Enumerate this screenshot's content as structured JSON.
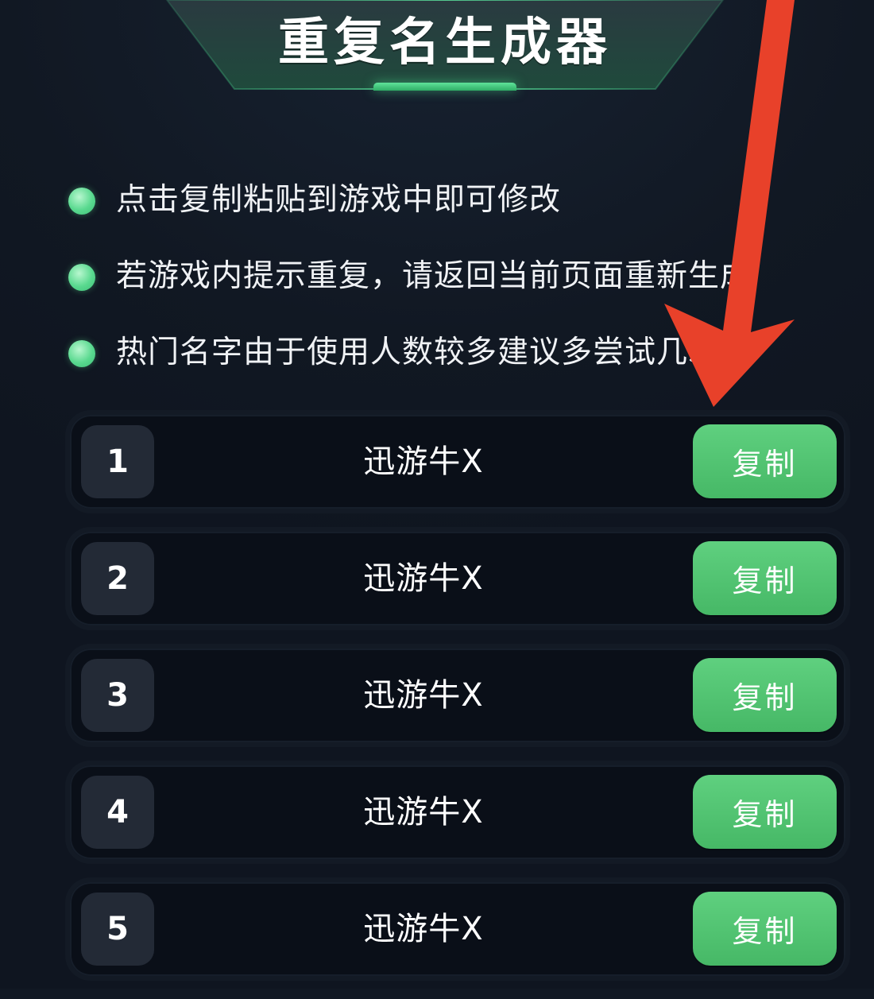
{
  "header": {
    "title": "重复名生成器"
  },
  "tips": [
    {
      "text": "点击复制粘贴到游戏中即可修改"
    },
    {
      "text": "若游戏内提示重复，请返回当前页面重新生成"
    },
    {
      "text": "热门名字由于使用人数较多建议多尝试几次"
    }
  ],
  "names": [
    {
      "index": "1",
      "name": "迅游牛X",
      "copy_label": "复制"
    },
    {
      "index": "2",
      "name": "迅游牛X",
      "copy_label": "复制"
    },
    {
      "index": "3",
      "name": "迅游牛X",
      "copy_label": "复制"
    },
    {
      "index": "4",
      "name": "迅游牛X",
      "copy_label": "复制"
    },
    {
      "index": "5",
      "name": "迅游牛X",
      "copy_label": "复制"
    }
  ],
  "colors": {
    "background": "#111823",
    "accent_green": "#4cbc6c",
    "row_background": "#0a0f18",
    "index_badge": "#232a36",
    "annotation_arrow": "#e8412a"
  },
  "icons": {
    "bullet": "green-dot-icon",
    "annotation": "red-arrow-icon"
  }
}
